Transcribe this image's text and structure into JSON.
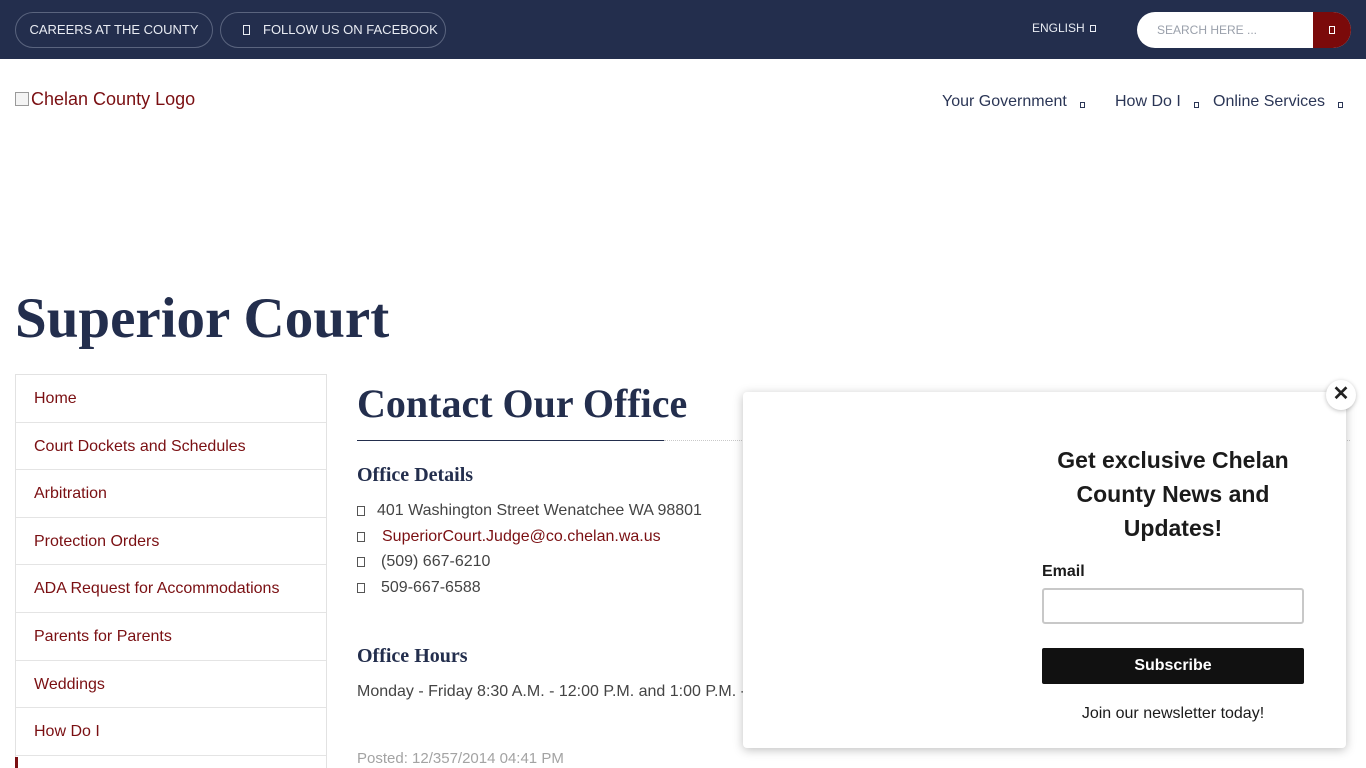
{
  "topbar": {
    "careers_label": "CAREERS AT THE COUNTY",
    "facebook_label": "FOLLOW US ON FACEBOOK",
    "language_label": "ENGLISH",
    "search_placeholder": "SEARCH HERE ..."
  },
  "header": {
    "logo_alt": "Chelan County Logo",
    "nav": [
      {
        "label": "Your Government"
      },
      {
        "label": "How Do I"
      },
      {
        "label": "Online Services"
      }
    ]
  },
  "page_title": "Superior Court",
  "sidebar": {
    "items": [
      {
        "label": "Home"
      },
      {
        "label": "Court Dockets and Schedules"
      },
      {
        "label": "Arbitration"
      },
      {
        "label": "Protection Orders"
      },
      {
        "label": "ADA Request for Accommodations"
      },
      {
        "label": "Parents for Parents"
      },
      {
        "label": "Weddings"
      },
      {
        "label": "How Do I"
      }
    ]
  },
  "main": {
    "section_title": "Contact Our Office",
    "details_heading": "Office Details",
    "address": "401 Washington Street Wenatchee WA 98801",
    "email": "SuperiorCourt.Judge@co.chelan.wa.us",
    "phone": "(509) 667-6210",
    "fax": "509-667-6588",
    "hours_heading": "Office Hours",
    "hours_text": "Monday - Friday 8:30 A.M. - 12:00 P.M. and 1:00 P.M. -",
    "posted": "Posted: 12/357/2014 04:41 PM"
  },
  "popup": {
    "close_label": "✕",
    "heading": "Get exclusive Chelan County News and Updates!",
    "email_label": "Email",
    "email_value": "",
    "subscribe_label": "Subscribe",
    "footer_text": "Join our newsletter today!"
  },
  "colors": {
    "topbar_bg": "#232e4d",
    "accent_red": "#7a0f12",
    "heading_navy": "#232e4d"
  }
}
